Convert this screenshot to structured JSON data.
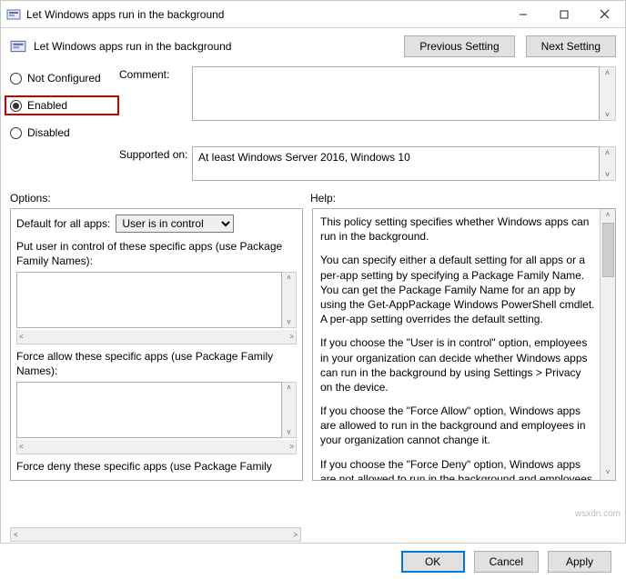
{
  "window": {
    "title": "Let Windows apps run in the background"
  },
  "header": {
    "title": "Let Windows apps run in the background",
    "previous_btn": "Previous Setting",
    "next_btn": "Next Setting"
  },
  "state": {
    "not_configured": "Not Configured",
    "enabled": "Enabled",
    "disabled": "Disabled",
    "selected": "enabled"
  },
  "labels": {
    "comment": "Comment:",
    "supported_on": "Supported on:",
    "options": "Options:",
    "help": "Help:"
  },
  "supported_on_text": "At least Windows Server 2016, Windows 10",
  "options": {
    "default_for_all": "Default for all apps:",
    "default_value": "User is in control",
    "put_user_label": "Put user in control of these specific apps (use Package Family Names):",
    "force_allow_label": "Force allow these specific apps (use Package Family Names):",
    "force_deny_label": "Force deny these specific apps (use Package Family"
  },
  "help": {
    "p1": "This policy setting specifies whether Windows apps can run in the background.",
    "p2": "You can specify either a default setting for all apps or a per-app setting by specifying a Package Family Name. You can get the Package Family Name for an app by using the Get-AppPackage Windows PowerShell cmdlet. A per-app setting overrides the default setting.",
    "p3": "If you choose the \"User is in control\" option, employees in your organization can decide whether Windows apps can run in the background by using Settings > Privacy on the device.",
    "p4": "If you choose the \"Force Allow\" option, Windows apps are allowed to run in the background and employees in your organization cannot change it.",
    "p5": "If you choose the \"Force Deny\" option, Windows apps are not allowed to run in the background and employees in your organization cannot change it."
  },
  "footer": {
    "ok": "OK",
    "cancel": "Cancel",
    "apply": "Apply"
  },
  "watermark": "wsxdn.com"
}
